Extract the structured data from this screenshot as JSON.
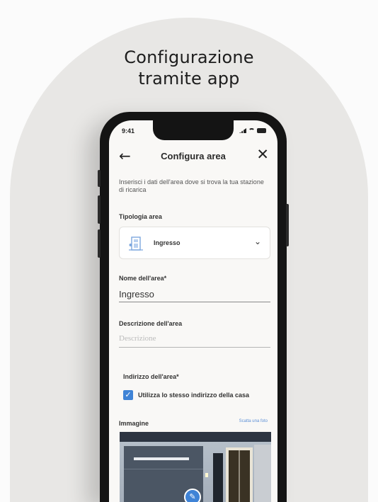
{
  "headline": {
    "line1": "Configurazione",
    "line2": "tramite app"
  },
  "status": {
    "time": "9:41"
  },
  "nav": {
    "back_icon": "←",
    "title": "Configura area",
    "close_icon": "✕"
  },
  "intro": "Inserisci i dati dell'area dove si trova la tua stazione di ricarica",
  "area_type": {
    "label": "Tipologia area",
    "selected": "Ingresso",
    "chevron": "⌄"
  },
  "area_name": {
    "label": "Nome dell'area*",
    "value": "Ingresso"
  },
  "area_description": {
    "label": "Descrizione dell'area",
    "placeholder": "Descrizione"
  },
  "area_address": {
    "label": "Indirizzo dell'area*",
    "checkbox_label": "Utilizza lo stesso indirizzo della casa",
    "checked": true,
    "check_glyph": "✓"
  },
  "image": {
    "label": "Immagine",
    "link": "Scatta una foto",
    "edit_icon": "✎"
  },
  "colors": {
    "accent": "#3f83d6",
    "arch": "#e8e7e5",
    "screen": "#f9f8f6"
  }
}
